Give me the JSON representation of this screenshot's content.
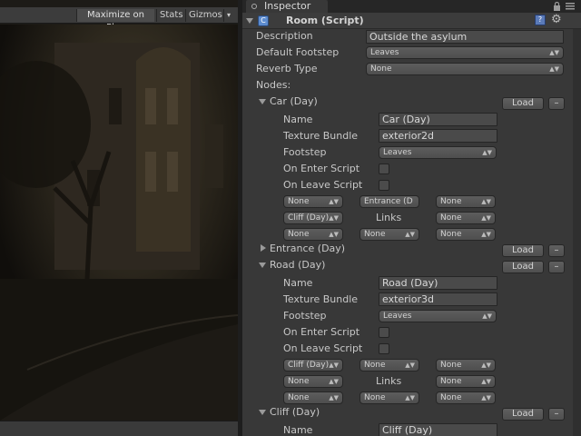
{
  "game_toolbar": {
    "maximize": "Maximize on Play",
    "stats": "Stats",
    "gizmos": "Gizmos",
    "arrow": "▾"
  },
  "inspector": {
    "tab_title": "Inspector",
    "component": {
      "title": "Room (Script)",
      "icon_letter": "C",
      "help": "?",
      "cog": "⚙"
    },
    "description_label": "Description",
    "description_value": "Outside the asylum",
    "default_footstep_label": "Default Footstep",
    "default_footstep_value": "Leaves",
    "reverb_label": "Reverb Type",
    "reverb_value": "None",
    "nodes_label": "Nodes:",
    "load_label": "Load",
    "minus_label": "–",
    "field_labels": {
      "name": "Name",
      "texture": "Texture Bundle",
      "footstep": "Footstep",
      "on_enter": "On Enter Script",
      "on_leave": "On Leave Script",
      "links": "Links"
    },
    "nodes": [
      {
        "title": "Car (Day)",
        "expanded": true,
        "name": "Car (Day)",
        "texture": "exterior2d",
        "footstep": "Leaves",
        "links": [
          [
            "None",
            "Entrance (D",
            "None"
          ],
          [
            "Cliff (Day)",
            "",
            "None"
          ],
          [
            "None",
            "None",
            "None"
          ]
        ]
      },
      {
        "title": "Entrance (Day)",
        "expanded": false
      },
      {
        "title": "Road (Day)",
        "expanded": true,
        "name": "Road (Day)",
        "texture": "exterior3d",
        "footstep": "Leaves",
        "links": [
          [
            "Cliff (Day)",
            "None",
            "None"
          ],
          [
            "None",
            "",
            "None"
          ],
          [
            "None",
            "None",
            "None"
          ]
        ]
      },
      {
        "title": "Cliff (Day)",
        "expanded": true,
        "name": "Cliff (Day)"
      }
    ]
  },
  "icons": {
    "lock": "lock-icon",
    "menu": "menu-icon",
    "foldout": "triangle-icon",
    "cog": "gear-icon",
    "help": "help-icon",
    "script": "script-icon"
  }
}
